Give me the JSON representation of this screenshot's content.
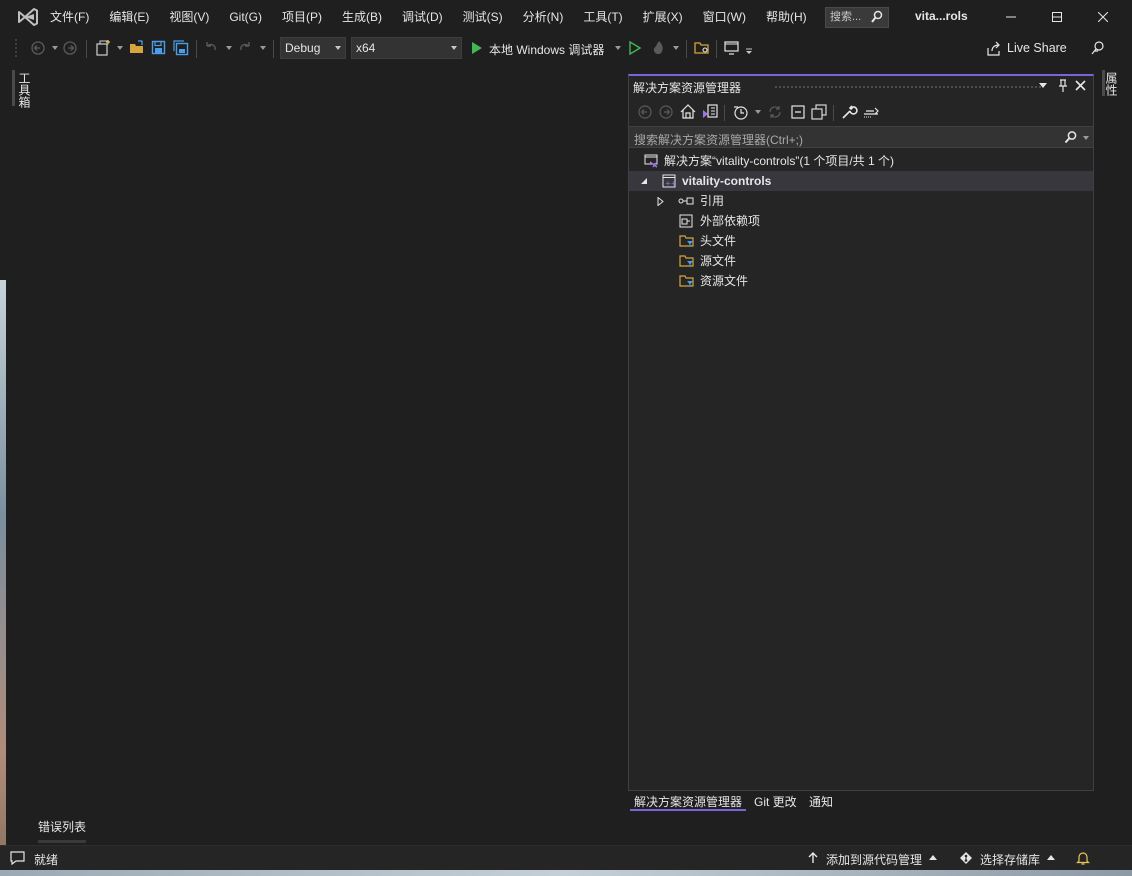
{
  "app": {
    "title": "vita...rols",
    "search_placeholder": "搜索..."
  },
  "menu": {
    "items": [
      "文件(F)",
      "编辑(E)",
      "视图(V)",
      "Git(G)",
      "项目(P)",
      "生成(B)",
      "调试(D)",
      "测试(S)",
      "分析(N)",
      "工具(T)",
      "扩展(X)",
      "窗口(W)",
      "帮助(H)"
    ]
  },
  "toolbar": {
    "config": "Debug",
    "platform": "x64",
    "run_label": "本地 Windows 调试器",
    "live_share": "Live Share"
  },
  "left_strip": {
    "toolbox_label": "工具箱"
  },
  "right_strip": {
    "properties_label": "属性"
  },
  "solution_explorer": {
    "title": "解决方案资源管理器",
    "search_placeholder": "搜索解决方案资源管理器(Ctrl+;)",
    "tree": {
      "solution": "解决方案“vitality-controls”(1 个项目/共 1 个)",
      "project": "vitality-controls",
      "references": "引用",
      "external_deps": "外部依赖项",
      "headers": "头文件",
      "sources": "源文件",
      "resources": "资源文件"
    },
    "tabs": [
      "解决方案资源管理器",
      "Git 更改",
      "通知"
    ]
  },
  "bottom_panel": {
    "error_list_tab": "错误列表"
  },
  "status_bar": {
    "ready": "就绪",
    "add_to_source_control": "添加到源代码管理",
    "select_repository": "选择存储库"
  },
  "colors": {
    "accent": "#7f63d6",
    "background": "#1f1f1f",
    "panel": "#252526",
    "run_green": "#3fb950",
    "save_blue": "#4a9ee8"
  }
}
